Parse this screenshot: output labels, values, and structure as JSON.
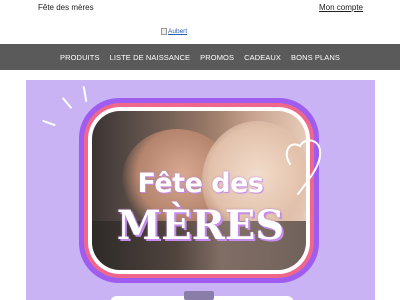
{
  "topbar": {
    "left_text": "Fête des mères",
    "account_link": "Mon compte"
  },
  "logo": {
    "alt_text": "Aubert"
  },
  "nav": {
    "items": [
      "PRODUITS",
      "LISTE DE NAISSANCE",
      "PROMOS",
      "CADEAUX",
      "BONS PLANS"
    ]
  },
  "hero": {
    "title_line1": "Fête des",
    "title_line2": "MÈRES",
    "colors": {
      "background": "#c9b3f4",
      "frame_purple": "#9e5cf0",
      "frame_pink": "#f0678c"
    },
    "icons": [
      "heart-outline-icon",
      "sparkle-rays-icon"
    ]
  }
}
